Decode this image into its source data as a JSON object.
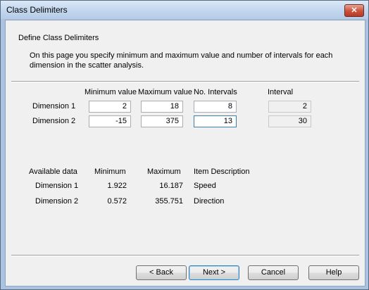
{
  "window": {
    "title": "Class Delimiters",
    "close_label": "✕"
  },
  "page": {
    "heading": "Define Class Delimiters",
    "description_line1": "On this page you specify minimum and maximum value and number of intervals for each",
    "description_line2": "dimension in the scatter analysis."
  },
  "delimiters": {
    "headers": {
      "min": "Minimum value",
      "max": "Maximum value",
      "intervals": "No. Intervals",
      "interval": "Interval"
    },
    "rows": [
      {
        "label": "Dimension 1",
        "min": "2",
        "max": "18",
        "intervals": "8",
        "interval": "2"
      },
      {
        "label": "Dimension 2",
        "min": "-15",
        "max": "375",
        "intervals": "13",
        "interval": "30"
      }
    ]
  },
  "available": {
    "headers": {
      "label": "Available data",
      "min": "Minimum",
      "max": "Maximum",
      "desc": "Item Description"
    },
    "rows": [
      {
        "label": "Dimension 1",
        "min": "1.922",
        "max": "16.187",
        "desc": "Speed"
      },
      {
        "label": "Dimension 2",
        "min": "0.572",
        "max": "355.751",
        "desc": "Direction"
      }
    ]
  },
  "buttons": {
    "back": "< Back",
    "next": "Next >",
    "cancel": "Cancel",
    "help": "Help"
  }
}
